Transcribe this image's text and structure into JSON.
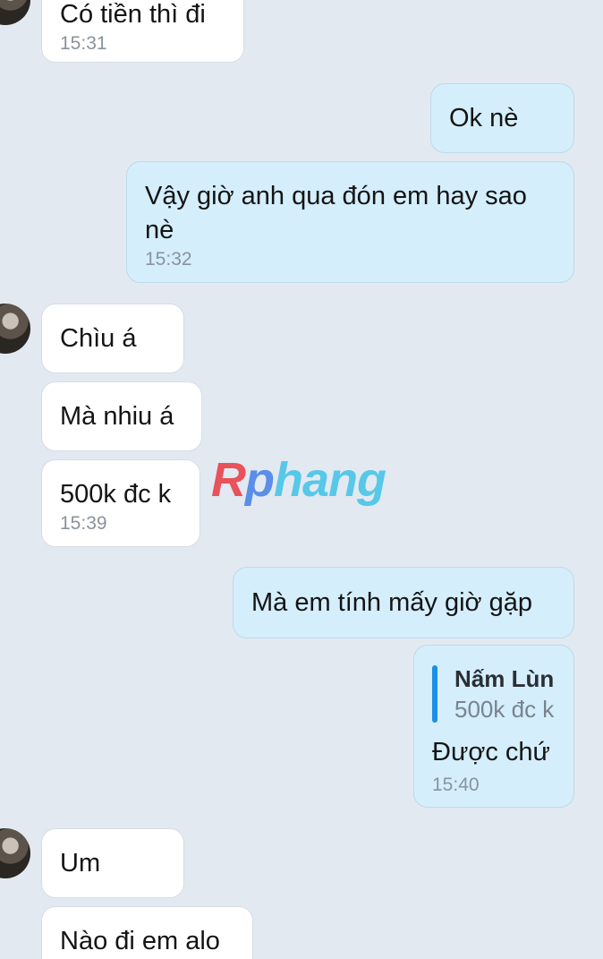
{
  "watermark": {
    "r": "R",
    "p": "p",
    "hang": "hang"
  },
  "messages": [
    {
      "side": "in",
      "text": "Có tiền thì đi",
      "time": "15:31"
    },
    {
      "side": "out",
      "text": "Ok nè"
    },
    {
      "side": "out",
      "text": "Vậy giờ anh qua đón em hay sao nè",
      "time": "15:32"
    },
    {
      "side": "in",
      "text": "Chìu á"
    },
    {
      "side": "in",
      "text": "Mà nhiu á"
    },
    {
      "side": "in",
      "text": "500k đc k",
      "time": "15:39"
    },
    {
      "side": "out",
      "text": "Mà em tính mấy giờ gặp"
    },
    {
      "side": "out",
      "quote": {
        "name": "Nấm Lùn",
        "text": "500k đc k"
      },
      "text": "Được chứ",
      "time": "15:40"
    },
    {
      "side": "in",
      "text": "Um"
    },
    {
      "side": "in",
      "text": "Nào đi em alo"
    }
  ],
  "colors": {
    "background": "#e2e9f1",
    "incoming_bubble": "#ffffff",
    "outgoing_bubble": "#d4eefc",
    "quote_bar": "#1e8ee6"
  }
}
